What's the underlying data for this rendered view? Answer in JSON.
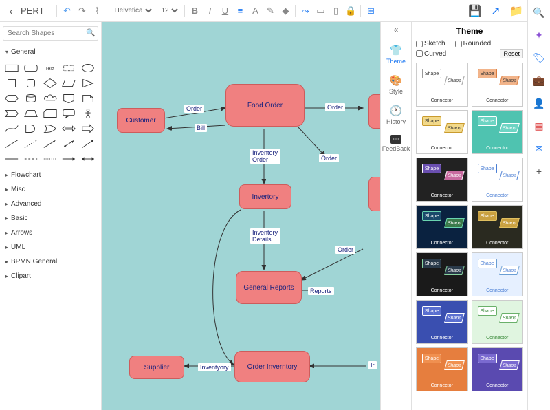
{
  "title": "PERT",
  "font_family": "Helvetica",
  "font_size": "12",
  "search_placeholder": "Search Shapes",
  "shape_categories": [
    "General",
    "Flowchart",
    "Misc",
    "Advanced",
    "Basic",
    "Arrows",
    "UML",
    "BPMN General",
    "Clipart"
  ],
  "canvas": {
    "nodes": {
      "customer": "Customer",
      "food_order": "Food Order",
      "invertory": "Invertory",
      "general_reports": "General Reports",
      "order_inventory": "Order Inverntory",
      "supplier": "Supplier"
    },
    "edges": {
      "e1": "Order",
      "e2": "Bill",
      "e3": "Order",
      "e4": "Inventory Order",
      "e5": "Order",
      "e6": "Inventory Details",
      "e7": "Order",
      "e8": "Reports",
      "e9": "Inventyory",
      "e10": "Ir"
    }
  },
  "right_tabs": {
    "theme": "Theme",
    "style": "Style",
    "history": "History",
    "feedback": "FeedBack"
  },
  "theme_panel": {
    "title": "Theme",
    "sketch": "Sketch",
    "rounded": "Rounded",
    "curved": "Curved",
    "reset": "Reset",
    "tile_shape": "Shape",
    "tile_connector": "Connector",
    "themes": [
      {
        "bg": "#ffffff",
        "s1": "#fff",
        "s2": "#fff",
        "bd": "#999",
        "fg": "#333"
      },
      {
        "bg": "#ffffff",
        "s1": "#f2b48a",
        "s2": "#f2b48a",
        "bd": "#d97b3e",
        "fg": "#333"
      },
      {
        "bg": "#ffffff",
        "s1": "#f2d98a",
        "s2": "#f2d98a",
        "bd": "#c99b2e",
        "fg": "#333"
      },
      {
        "bg": "#4fc3b0",
        "s1": "#6dd4c3",
        "s2": "#6dd4c3",
        "bd": "#fff",
        "fg": "#fff"
      },
      {
        "bg": "#222222",
        "s1": "#6a4fb0",
        "s2": "#c96aa0",
        "bd": "#fff",
        "fg": "#fff"
      },
      {
        "bg": "#ffffff",
        "s1": "#fff",
        "s2": "#fff",
        "bd": "#4a7ed4",
        "fg": "#4a7ed4"
      },
      {
        "bg": "#0a2240",
        "s1": "#1a4a6a",
        "s2": "#3a7a4a",
        "bd": "#6ad4b0",
        "fg": "#fff"
      },
      {
        "bg": "#2a2a20",
        "s1": "#c9a040",
        "s2": "#c9a040",
        "bd": "#e0c060",
        "fg": "#fff"
      },
      {
        "bg": "#1a1a1a",
        "s1": "#2a3a4a",
        "s2": "#2a3a4a",
        "bd": "#8ad4a0",
        "fg": "#fff"
      },
      {
        "bg": "#e6f0ff",
        "s1": "#fff",
        "s2": "#fff",
        "bd": "#6a9ed4",
        "fg": "#4a7ed4"
      },
      {
        "bg": "#3a4fb0",
        "s1": "#5a6fd0",
        "s2": "#5a6fd0",
        "bd": "#fff",
        "fg": "#fff"
      },
      {
        "bg": "#e0f5e0",
        "s1": "#fff",
        "s2": "#fff",
        "bd": "#6ab06a",
        "fg": "#3a8a3a"
      },
      {
        "bg": "#e67e3e",
        "s1": "#f09050",
        "s2": "#f09050",
        "bd": "#fff",
        "fg": "#fff"
      },
      {
        "bg": "#5a4ab0",
        "s1": "#7a6ad0",
        "s2": "#7a6ad0",
        "bd": "#fff",
        "fg": "#fff"
      }
    ]
  }
}
